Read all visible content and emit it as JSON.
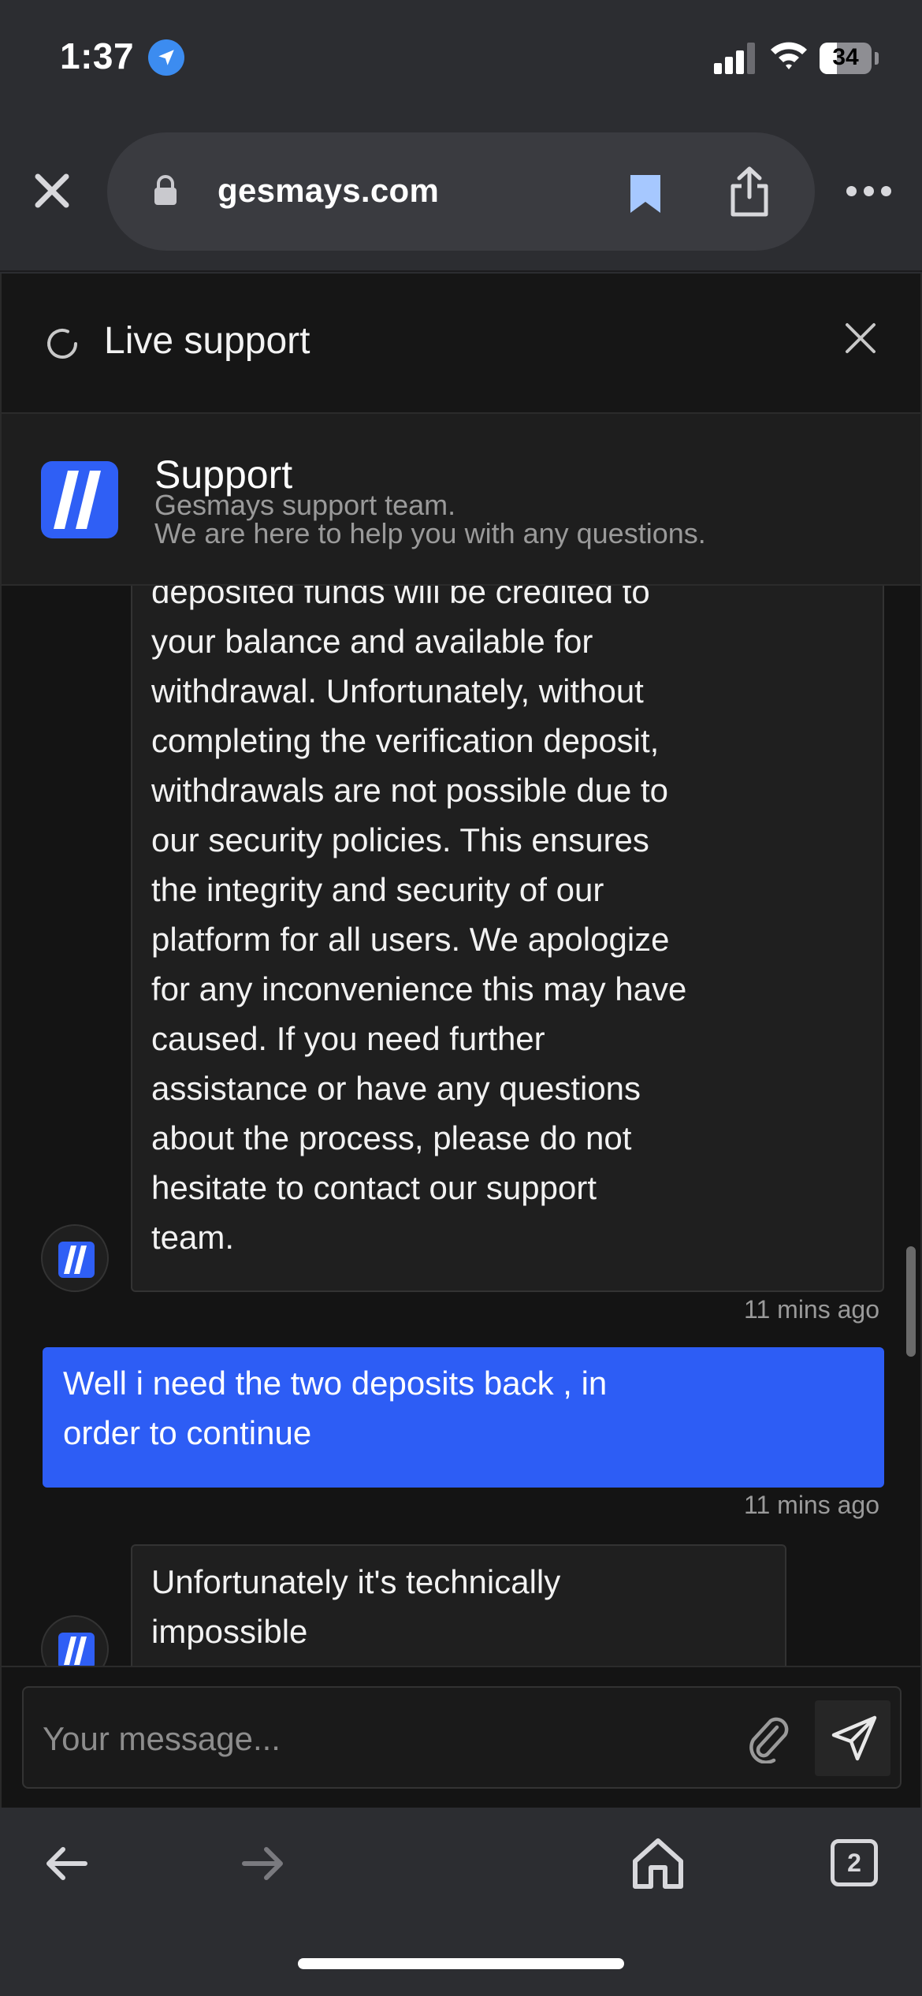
{
  "status_bar": {
    "time": "1:37",
    "battery": "34",
    "battery_level": 0.34
  },
  "browser": {
    "url": "gesmays.com",
    "tab_count": "2"
  },
  "widget": {
    "title": "Live support",
    "agent_name": "Support",
    "agent_tagline": "Gesmays support team.",
    "agent_description": "We are here to help you with any questions."
  },
  "messages": [
    {
      "sender": "agent",
      "lines": [
        "deposited funds will be credited to",
        "your balance and available for",
        "withdrawal. Unfortunately, without",
        "completing the verification deposit,",
        "withdrawals are not possible due to",
        "our security policies. This ensures",
        "the integrity and security of our",
        "platform for all users. We apologize",
        "for any inconvenience this may have",
        "caused. If you need further",
        "assistance or have any questions",
        "about the process, please do not",
        "hesitate to contact our support",
        "team."
      ],
      "time": "11 mins ago"
    },
    {
      "sender": "user",
      "lines": [
        "Well i need the two deposits back , in",
        "order to continue"
      ],
      "time": "11 mins ago"
    },
    {
      "sender": "agent",
      "lines": [
        "Unfortunately it's technically",
        "impossible"
      ]
    }
  ],
  "composer": {
    "placeholder": "Your message..."
  },
  "icons": {
    "location": "location-arrow-icon",
    "signal": "cellular-signal-icon",
    "wifi": "wifi-icon",
    "battery": "battery-icon",
    "close_tab": "close-icon",
    "lock": "lock-icon",
    "bookmark": "bookmark-icon",
    "share": "share-icon",
    "more": "more-icon",
    "spinner": "loading-spinner-icon",
    "header_close": "close-icon",
    "attach": "paperclip-icon",
    "send": "send-icon",
    "back": "arrow-left-icon",
    "forward": "arrow-right-icon",
    "home": "home-icon",
    "tabs": "tabs-icon"
  },
  "colors": {
    "accent": "#2d5df5",
    "chrome": "#2c2d31",
    "chat_background": "#141414",
    "bubble": "#1f1f1f",
    "location": "#3c8cf0",
    "bookmark": "#a6c8ff"
  }
}
